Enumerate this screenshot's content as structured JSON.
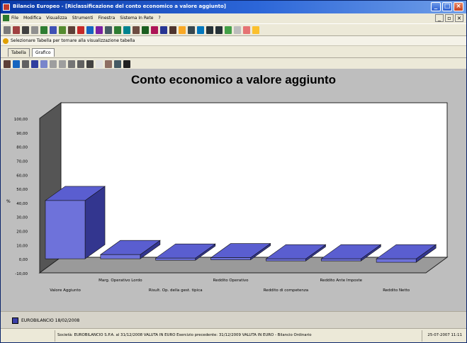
{
  "window": {
    "title": "Bilancio Europeo - [Riclassificazione del conto economico a valore aggiunto]"
  },
  "menu": {
    "items": [
      "File",
      "Modifica",
      "Visualizza",
      "Strumenti",
      "Finestra",
      "Sistema In Rete",
      "?"
    ]
  },
  "selection_bar": {
    "message": "Selezionare Tabella per tornare alla visualizzazione tabella"
  },
  "tabs": [
    {
      "label": "Tabella",
      "active": false
    },
    {
      "label": "Grafico",
      "active": true
    }
  ],
  "chart_data": {
    "type": "bar",
    "title": "Conto economico a valore aggiunto",
    "ylabel": "%",
    "ylim": [
      -10,
      100
    ],
    "yticks": [
      "100,00",
      "90,00",
      "80,00",
      "70,00",
      "60,00",
      "50,00",
      "40,00",
      "30,00",
      "20,00",
      "10,00",
      "0,00",
      "-10,00"
    ],
    "categories": [
      "Valore Aggiunto",
      "Marg. Operativo Lordo",
      "Risult. Op. della gest. tipica",
      "Reddito Operativo",
      "Reddito di competenza",
      "Reddito Ante Imposte",
      "Reddito Netto"
    ],
    "values": [
      41.5,
      3,
      0.5,
      0.8,
      -1,
      -1.5,
      -2.5
    ],
    "grid": false,
    "style": "3d"
  },
  "legend": {
    "label": "EUROBILANCIO 18/02/2008"
  },
  "status_bar": {
    "company_info": "Società: EUROBILANCIO S.P.A. al 31/12/2008 VALUTA IN EURO  Esercizio precedente: 31/12/2009 VALUTA IN EURO - Bilancio Ordinario",
    "date_time": "25-07-2007 11:11"
  },
  "colors": {
    "titlebar": "#0a3aa8",
    "bar_front": "#5a5ed0",
    "bar_top": "#3b3fa8",
    "chart_bg": "#ffffff"
  }
}
